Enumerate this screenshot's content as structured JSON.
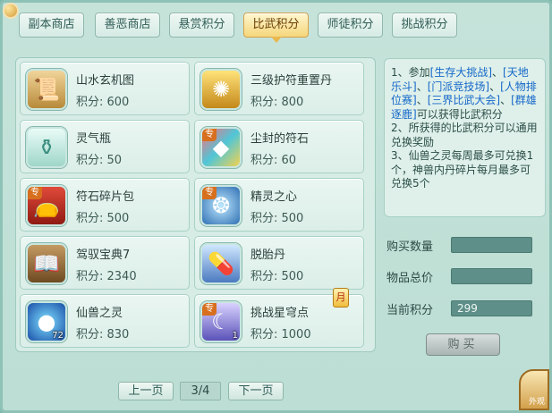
{
  "tabs": [
    {
      "label": "副本商店"
    },
    {
      "label": "善恶商店"
    },
    {
      "label": "悬赏积分"
    },
    {
      "label": "比武积分",
      "active": true
    },
    {
      "label": "师徒积分"
    },
    {
      "label": "挑战积分"
    }
  ],
  "items": [
    {
      "name": "山水玄机图",
      "points": "积分: 600",
      "icon": "scroll-icon",
      "tag": "",
      "count": ""
    },
    {
      "name": "三级护符重置丹",
      "points": "积分: 800",
      "icon": "golden-amulet-icon",
      "tag": "",
      "count": ""
    },
    {
      "name": "灵气瓶",
      "points": "积分: 50",
      "icon": "vase-icon",
      "tag": "",
      "count": ""
    },
    {
      "name": "尘封的符石",
      "points": "积分: 60",
      "icon": "gem-stone-icon",
      "tag": "专",
      "count": ""
    },
    {
      "name": "符石碎片包",
      "points": "积分: 500",
      "icon": "pouch-icon",
      "tag": "专",
      "count": ""
    },
    {
      "name": "精灵之心",
      "points": "积分: 500",
      "icon": "spirit-heart-icon",
      "tag": "专",
      "count": ""
    },
    {
      "name": "驾驭宝典7",
      "points": "积分: 2340",
      "icon": "book-icon",
      "tag": "",
      "count": ""
    },
    {
      "name": "脱胎丹",
      "points": "积分: 500",
      "icon": "pill-icon",
      "tag": "",
      "count": ""
    },
    {
      "name": "仙兽之灵",
      "points": "积分: 830",
      "icon": "blue-orb-icon",
      "tag": "",
      "count": "72"
    },
    {
      "name": "挑战星穹点",
      "points": "积分: 1000",
      "icon": "crescent-moon-icon",
      "tag": "专",
      "count": "1",
      "badge": "月"
    }
  ],
  "info": {
    "line1_prefix": "1、参加",
    "link1": "[生存大挑战]",
    "sep1": "、",
    "link2": "[天地乐斗]",
    "sep2": "、",
    "link3": "[门派竞技场]",
    "sep3": "、",
    "link4": "[人物排位赛]",
    "sep4": "、",
    "link5": "[三界比武大会]",
    "sep5": "、",
    "link6": "[群雄逐鹿]",
    "line1_suffix": "可以获得比武积分",
    "line2": "2、所获得的比武积分可以通用兑换奖励",
    "line3": "3、仙兽之灵每周最多可兑换1个，神兽内丹碎片每月最多可兑换5个"
  },
  "purchase": {
    "qty_label": "购买数量",
    "qty_value": "",
    "total_label": "物品总价",
    "total_value": "",
    "current_label": "当前积分",
    "current_value": "299",
    "buy_button": "购买"
  },
  "pager": {
    "prev": "上一页",
    "page": "3/4",
    "next": "下一页"
  },
  "corner_label": "外观"
}
